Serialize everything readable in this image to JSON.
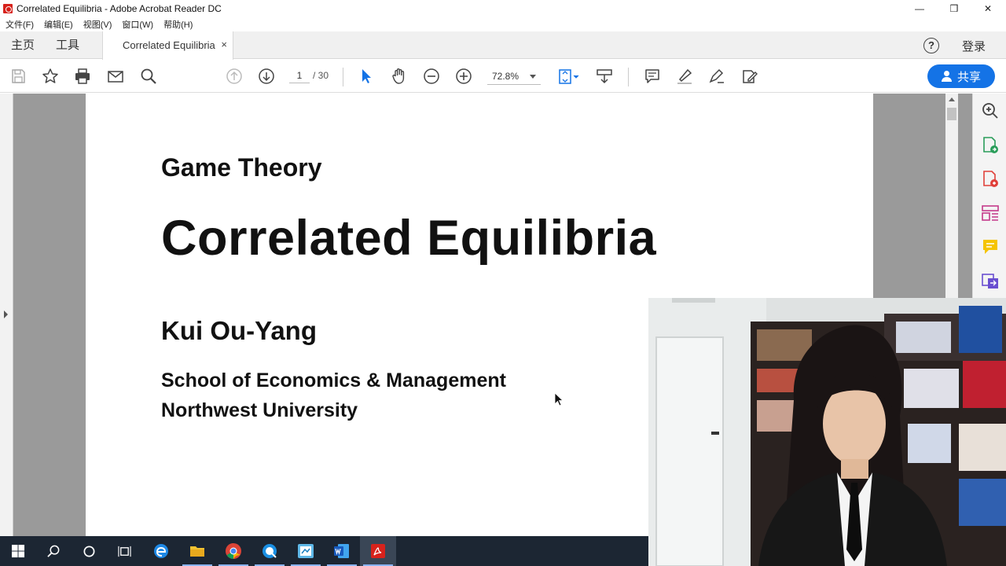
{
  "window": {
    "title": "Correlated Equilibria - Adobe Acrobat Reader DC",
    "minimize": "—",
    "restore": "❒",
    "close": "✕"
  },
  "menu": [
    "文件(F)",
    "编辑(E)",
    "视图(V)",
    "窗口(W)",
    "帮助(H)"
  ],
  "tabs": {
    "home": "主页",
    "tools": "工具",
    "document": "Correlated Equilibria",
    "close": "×",
    "help": "?",
    "signin": "登录"
  },
  "toolbar": {
    "page_current": "1",
    "page_total": "/ 30",
    "zoom": "72.8%",
    "share": "共享",
    "accent": "#1473e6",
    "icons": [
      "save-icon",
      "bookmark-star-icon",
      "print-icon",
      "email-icon",
      "search-icon",
      "previous-page-icon",
      "next-page-icon",
      "select-cursor-icon",
      "hand-tool-icon",
      "zoom-out-icon",
      "zoom-in-icon",
      "fit-page-icon",
      "scroll-mode-icon",
      "comment-icon",
      "highlight-icon",
      "sign-icon",
      "fill-sign-icon"
    ]
  },
  "document": {
    "course": "Game Theory",
    "title": "Correlated Equilibria",
    "author": "Kui Ou-Yang",
    "affiliation_1": "School of Economics & Management",
    "affiliation_2": "Northwest University"
  },
  "right_panel": {
    "icons": [
      "zoom-panel-icon",
      "export-pdf-icon",
      "create-pdf-icon",
      "organize-pages-icon",
      "comment-panel-icon",
      "convert-icon"
    ]
  },
  "taskbar": {
    "apps": [
      "windows-start-icon",
      "search-icon",
      "cortana-icon",
      "task-view-icon",
      "edge-icon",
      "file-explorer-icon",
      "chrome-icon",
      "qq-browser-icon",
      "app-icon",
      "word-icon",
      "acrobat-icon"
    ]
  },
  "webcam": {
    "description_hidden": ""
  }
}
